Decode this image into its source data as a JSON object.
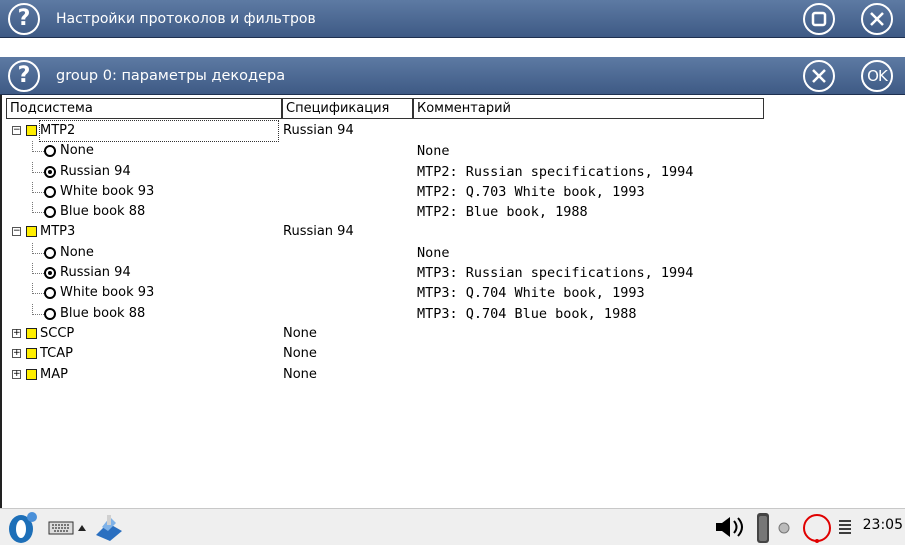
{
  "window": {
    "title": "Настройки протоколов и фильтров"
  },
  "dialog": {
    "title": "group 0: параметры декодера"
  },
  "table": {
    "columns": [
      "Подсистема",
      "Спецификация",
      "Комментарий"
    ],
    "rows": [
      {
        "level": 0,
        "expander": "minus",
        "label": "MTP2",
        "spec": "Russian 94",
        "comment": ""
      },
      {
        "level": 1,
        "radio": false,
        "label": "None",
        "spec": "",
        "comment": "None"
      },
      {
        "level": 1,
        "radio": true,
        "label": "Russian 94",
        "spec": "",
        "comment": "MTP2: Russian specifications, 1994"
      },
      {
        "level": 1,
        "radio": false,
        "label": "White book 93",
        "spec": "",
        "comment": "MTP2: Q.703 White book, 1993"
      },
      {
        "level": 1,
        "radio": false,
        "label": "Blue book 88",
        "spec": "",
        "comment": "MTP2: Blue book, 1988"
      },
      {
        "level": 0,
        "expander": "minus",
        "label": "MTP3",
        "spec": "Russian 94",
        "comment": ""
      },
      {
        "level": 1,
        "radio": false,
        "label": "None",
        "spec": "",
        "comment": "None"
      },
      {
        "level": 1,
        "radio": true,
        "label": "Russian 94",
        "spec": "",
        "comment": "MTP3: Russian specifications, 1994"
      },
      {
        "level": 1,
        "radio": false,
        "label": "White book 93",
        "spec": "",
        "comment": "MTP3: Q.704 White book, 1993"
      },
      {
        "level": 1,
        "radio": false,
        "label": "Blue book 88",
        "spec": "",
        "comment": "MTP3: Q.704 Blue book, 1988"
      },
      {
        "level": 0,
        "expander": "plus",
        "label": "SCCP",
        "spec": "None",
        "comment": ""
      },
      {
        "level": 0,
        "expander": "plus",
        "label": "TCAP",
        "spec": "None",
        "comment": ""
      },
      {
        "level": 0,
        "expander": "plus",
        "label": "MAP",
        "spec": "None",
        "comment": ""
      }
    ]
  },
  "taskbar": {
    "clock": "23:05",
    "icons": [
      "start-menu-icon",
      "keyboard-icon",
      "arrow-up-icon",
      "app-icon",
      "speaker-icon",
      "battery-icon",
      "network-dot-icon",
      "record-circle-icon",
      "menu-lines-icon"
    ]
  },
  "colors": {
    "titlebar": "#4a6792",
    "node_square": "#ffee00"
  }
}
